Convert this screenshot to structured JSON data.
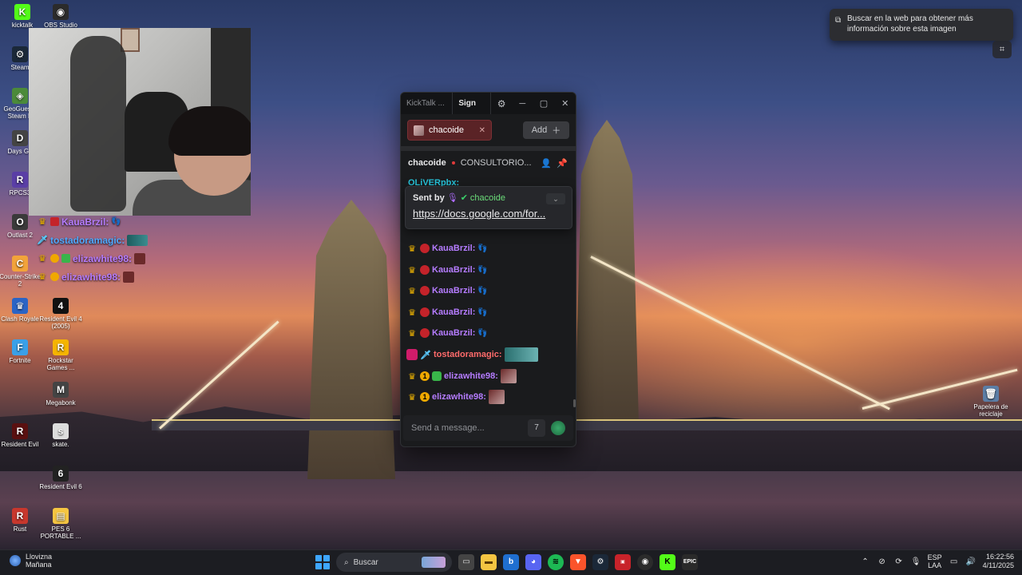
{
  "desktop_icons": [
    {
      "label": "kicktalk",
      "glyph": "K",
      "color": "#53fc18"
    },
    {
      "label": "OBS Studio",
      "glyph": "◉",
      "color": "#2b2b2b"
    },
    {
      "label": "Steam",
      "glyph": "⚙",
      "color": "#1b2838"
    },
    {
      "label": "GeoGuessr Steam E",
      "glyph": "◈",
      "color": "#4b8a3a"
    },
    {
      "label": "Days Go",
      "glyph": "D",
      "color": "#444"
    },
    {
      "label": "RPCS3",
      "glyph": "R",
      "color": "#5a3ea6"
    },
    {
      "label": "Outlast 2",
      "glyph": "O",
      "color": "#3a3a3a"
    },
    {
      "label": "Counter-Strike 2",
      "glyph": "C",
      "color": "#f2a33a"
    },
    {
      "label": "Clash Royale",
      "glyph": "♛",
      "color": "#2b64c5"
    },
    {
      "label": "Resident Evil 4 (2005)",
      "glyph": "4",
      "color": "#111"
    },
    {
      "label": "Fortnite",
      "glyph": "F",
      "color": "#3aa0e8"
    },
    {
      "label": "Rockstar Games ...",
      "glyph": "R",
      "color": "#f5b400"
    },
    {
      "label": "Megabonk",
      "glyph": "M",
      "color": "#444"
    },
    {
      "label": "Resident Evil",
      "glyph": "R",
      "color": "#5a1010"
    },
    {
      "label": "skate.",
      "glyph": "s",
      "color": "#ddd"
    },
    {
      "label": "Resident Evil 6",
      "glyph": "6",
      "color": "#222"
    },
    {
      "label": "Rust",
      "glyph": "R",
      "color": "#c8372d"
    },
    {
      "label": "PES 6 PORTABLE ...",
      "glyph": "▤",
      "color": "#f5c542"
    },
    {
      "label": "Papelera de reciclaje",
      "glyph": "🗑",
      "color": "#5c7ea6"
    }
  ],
  "overlay_chat": [
    {
      "user": "KauaBrzil:",
      "color": "#b57cff"
    },
    {
      "user": "tostadoramagic:",
      "color": "#4ea9ff"
    },
    {
      "user": "elizawhite98:",
      "color": "#b57cff"
    },
    {
      "user": "elizawhite98:",
      "color": "#b57cff"
    }
  ],
  "kicktalk": {
    "app_title": "KickTalk ...",
    "sign_in": "Sign In",
    "tab_channel": "chacoide",
    "add_label": "Add",
    "channel_name": "chacoide",
    "stream_title": "CONSULTORIO...",
    "partial_top_user": "OLiVERpbx:",
    "pinned": {
      "sent_by": "Sent by",
      "sender": "chacoide",
      "link": "https://docs.google.com/for..."
    },
    "messages": [
      {
        "user": "KauaBrzil:",
        "color": "#b57cff",
        "badges": [
          "crown",
          "sub"
        ],
        "emote": "feet"
      },
      {
        "user": "KauaBrzil:",
        "color": "#b57cff",
        "badges": [
          "crown",
          "sub"
        ],
        "emote": "feet"
      },
      {
        "user": "KauaBrzil:",
        "color": "#b57cff",
        "badges": [
          "crown",
          "sub"
        ],
        "emote": "feet"
      },
      {
        "user": "KauaBrzil:",
        "color": "#b57cff",
        "badges": [
          "crown",
          "sub"
        ],
        "emote": "feet"
      },
      {
        "user": "KauaBrzil:",
        "color": "#b57cff",
        "badges": [
          "crown",
          "sub"
        ],
        "emote": "feet"
      },
      {
        "user": "tostadoramagic:",
        "color": "#ff6b6b",
        "badges": [
          "pink",
          "sword"
        ],
        "emote": "wide"
      },
      {
        "user": "elizawhite98:",
        "color": "#b57cff",
        "badges": [
          "crown",
          "one",
          "bot"
        ],
        "emote": "img"
      },
      {
        "user": "elizawhite98:",
        "color": "#b57cff",
        "badges": [
          "crown",
          "one"
        ],
        "emote": "img"
      }
    ],
    "input_placeholder": "Send a message...",
    "accent_color": "#53fc18"
  },
  "lens_tooltip": "Buscar en la web para obtener más información sobre esta imagen",
  "taskbar": {
    "weather_condition": "Llovizna",
    "weather_time": "Mañana",
    "search_placeholder": "Buscar",
    "lang_top": "ESP",
    "lang_bottom": "LAA",
    "time": "16:22:56",
    "date": "4/11/2025",
    "apps": [
      "file-explorer",
      "edge",
      "discord",
      "spotify",
      "brave",
      "steam",
      "steelseries",
      "obs",
      "kicktalk",
      "epic-games"
    ]
  }
}
